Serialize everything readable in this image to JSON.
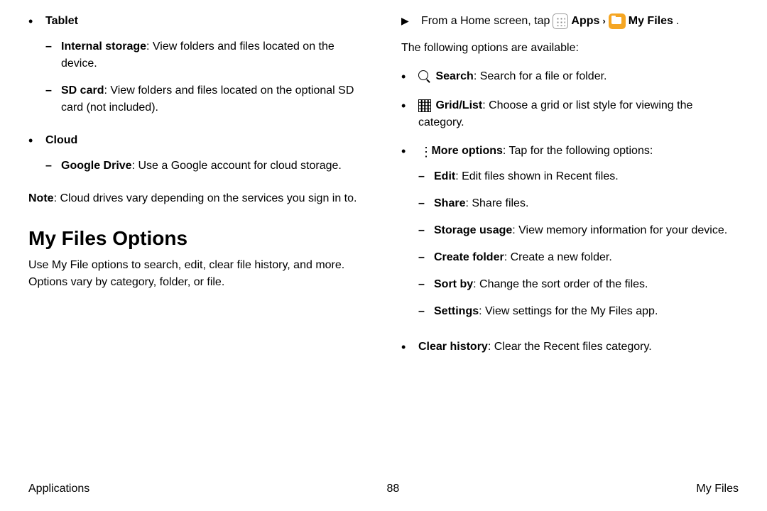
{
  "left": {
    "tablet_label": "Tablet",
    "internal_storage_label": "Internal storage",
    "internal_storage_desc": ": View folders and files located on the device.",
    "sd_card_label": "SD card",
    "sd_card_desc": ": View folders and files located on the optional SD card (not included).",
    "cloud_label": "Cloud",
    "google_drive_label": "Google Drive",
    "google_drive_desc": ": Use a Google account for cloud storage.",
    "note_label": "Note",
    "note_desc": ": Cloud drives vary depending on the services you sign in to.",
    "heading": "My Files Options",
    "intro": "Use My File options to search, edit, clear file history, and more. Options vary by category, folder, or file."
  },
  "right": {
    "from_home_pre": "From a Home screen, tap",
    "apps_label": "Apps",
    "my_files_label": "My Files",
    "period": ".",
    "available_text": "The following options are available:",
    "search_label": "Search",
    "search_desc": ": Search for a file or folder.",
    "gridlist_label": "Grid/List",
    "gridlist_desc": ": Choose a grid or list style for viewing the category.",
    "more_options_label": "More options",
    "more_options_desc": ": Tap for the following options:",
    "edit_label": "Edit",
    "edit_desc": ": Edit files shown in Recent files.",
    "share_label": "Share",
    "share_desc": ": Share files.",
    "storage_usage_label": "Storage usage",
    "storage_usage_desc": ": View memory information for your device.",
    "create_folder_label": "Create folder",
    "create_folder_desc": ": Create a new folder.",
    "sort_by_label": "Sort by",
    "sort_by_desc": ": Change the sort order of the files.",
    "settings_label": "Settings",
    "settings_desc": ": View settings for the My Files app.",
    "clear_history_label": "Clear history",
    "clear_history_desc": ": Clear the Recent files category."
  },
  "footer": {
    "left": "Applications",
    "center": "88",
    "right": "My Files"
  }
}
